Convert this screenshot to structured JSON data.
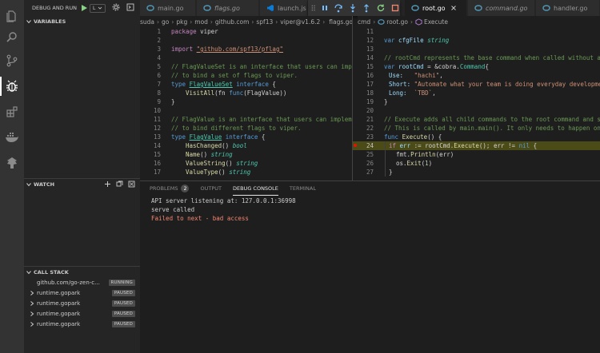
{
  "sidebar": {
    "run_label": "DEBUG AND RUN",
    "config_value": "L",
    "variables_title": "VARIABLES",
    "watch_title": "WATCH",
    "callstack_title": "CALL STACK",
    "stack": [
      {
        "name": "github.com/go-zen-c...",
        "status": "RUNNING"
      },
      {
        "name": "runtime.gopark",
        "status": "PAUSED"
      },
      {
        "name": "runtime.gopark",
        "status": "PAUSED"
      },
      {
        "name": "runtime.gopark",
        "status": "PAUSED"
      },
      {
        "name": "runtime.gopark",
        "status": "PAUSED"
      }
    ]
  },
  "tabs": {
    "main": "main.go",
    "flags": "flags.go",
    "launch": "launch.js",
    "root": "root.go",
    "command": "command.go",
    "handler": "handler.go"
  },
  "breadcrumbs_left": [
    "suda",
    "go",
    "pkg",
    "mod",
    "github.com",
    "spf13",
    "viper@v1.6.2",
    "flags.go"
  ],
  "breadcrumbs_right": [
    "cmd",
    "root.go",
    "Execute"
  ],
  "left_editor": {
    "line_numbers": [
      "1",
      "2",
      "3",
      "4",
      "5",
      "6",
      "7",
      "8",
      "9",
      "10",
      "11",
      "12",
      "13",
      "14",
      "15",
      "16",
      "17"
    ]
  },
  "right_editor": {
    "line_numbers": [
      "11",
      "12",
      "13",
      "14",
      "15",
      "16",
      "17",
      "18",
      "19",
      "20",
      "21",
      "22",
      "23",
      "24",
      "25",
      "26",
      "27"
    ]
  },
  "code_left": {
    "l1_kw": "package",
    "l1_rest": " viper",
    "l3_kw": "import",
    "l3_str": "\"github.com/spf13/pflag\"",
    "l5": "// FlagValueSet is an interface that users can implement",
    "l6": "// to bind a set of flags to viper.",
    "l7_kw": "type",
    "l7_ty": "FlagValueSet",
    "l7_kw2": "interface",
    "l7_brace": " {",
    "l8_fn": "VisitAll",
    "l8_a": "(fn ",
    "l8_kw": "func",
    "l8_b": "(FlagValue))",
    "l9": "}",
    "l11": "// FlagValue is an interface that users can implement",
    "l12": "// to bind different flags to viper.",
    "l13_kw": "type",
    "l13_ty": "FlagValue",
    "l13_kw2": "interface",
    "l13_brace": " {",
    "l14_fn": "HasChanged",
    "l14_p": "() ",
    "l14_ty": "bool",
    "l15_fn": "Name",
    "l15_p": "() ",
    "l15_ty": "string",
    "l16_fn": "ValueString",
    "l16_p": "() ",
    "l16_ty": "string",
    "l17_fn": "ValueType",
    "l17_p": "() ",
    "l17_ty": "string"
  },
  "code_right": {
    "l12_kw": "var",
    "l12_var": " cfgFile ",
    "l12_ty": "string",
    "l14": "// rootCmd represents the base command when called without any",
    "l15_kw": "var",
    "l15_var": " rootCmd",
    "l15_rest": " = &cobra.",
    "l15_ty": "Command",
    "l15_brace": "{",
    "l16_k": "Use:",
    "l16_s": "\"hachi\"",
    "l16_c": ",",
    "l17_k": "Short:",
    "l17_s": "\"Automate what your team is doing everyday development\"",
    "l18_k": "Long:",
    "l18_s": "`TBD`",
    "l18_c": ",",
    "l19": "}",
    "l21": "// Execute adds all child commands to the root command and sets",
    "l22": "// This is called by main.main(). It only needs to happen once",
    "l23_kw": "func",
    "l23_fn": "Execute",
    "l23_rest": "() {",
    "l24_kw": "if",
    "l24_var": " err",
    "l24_a": " := rootCmd.",
    "l24_fn": "Execute",
    "l24_b": "(); err != ",
    "l24_kw2": "nil",
    "l24_c": " {",
    "l25_a": "fmt.",
    "l25_fn": "Println",
    "l25_b": "(err)",
    "l26_a": "os.",
    "l26_fn": "Exit",
    "l26_b": "(",
    "l26_num": "1",
    "l26_c": ")",
    "l27": "}"
  },
  "panel": {
    "tabs": [
      "PROBLEMS",
      "OUTPUT",
      "DEBUG CONSOLE",
      "TERMINAL"
    ],
    "problems_count": "2",
    "console_lines": [
      "API server listening at: 127.0.0.1:36998",
      "serve called",
      "Failed to next - bad access"
    ]
  },
  "colors": {
    "error_text": "#f48771",
    "breakpoint": "#e51400",
    "current_line": "#4b4b18",
    "go_icon": "#519aba",
    "vscode_icon": "#0a7bd6"
  }
}
